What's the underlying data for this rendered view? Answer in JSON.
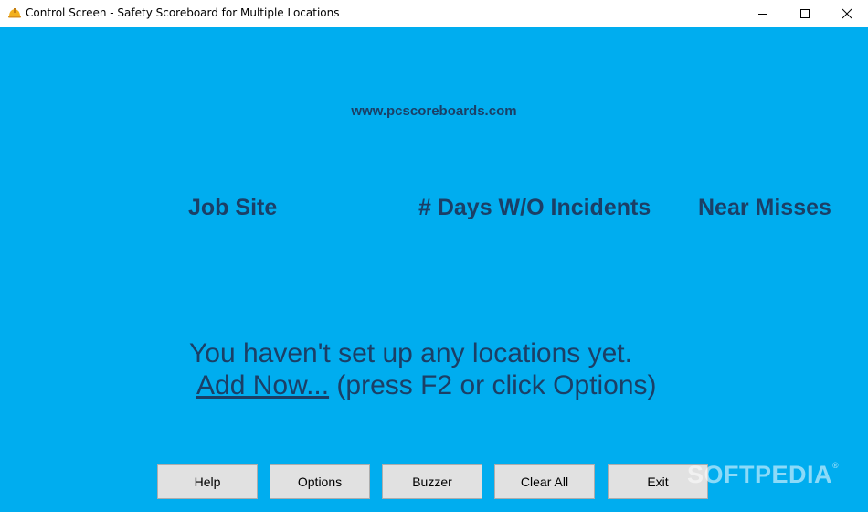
{
  "window": {
    "title": "Control Screen - Safety Scoreboard for Multiple Locations",
    "icon": "hard-hat-icon",
    "controls": [
      "minimize-icon",
      "maximize-icon",
      "close-icon"
    ]
  },
  "main": {
    "website": "www.pcscoreboards.com",
    "columns": {
      "job_site": "Job Site",
      "days": "# Days W/O Incidents",
      "near_misses": "Near Misses"
    },
    "empty_message": "You haven't set up any locations yet.",
    "add_link": "Add Now...",
    "add_hint": " (press F2 or click Options)"
  },
  "buttons": {
    "help": "Help",
    "options": "Options",
    "buzzer": "Buzzer",
    "clear_all": "Clear All",
    "exit": "Exit"
  },
  "watermark": "SOFTPEDIA",
  "colors": {
    "background": "#00adef",
    "text": "#1b3f66",
    "button": "#e1e1e1"
  }
}
